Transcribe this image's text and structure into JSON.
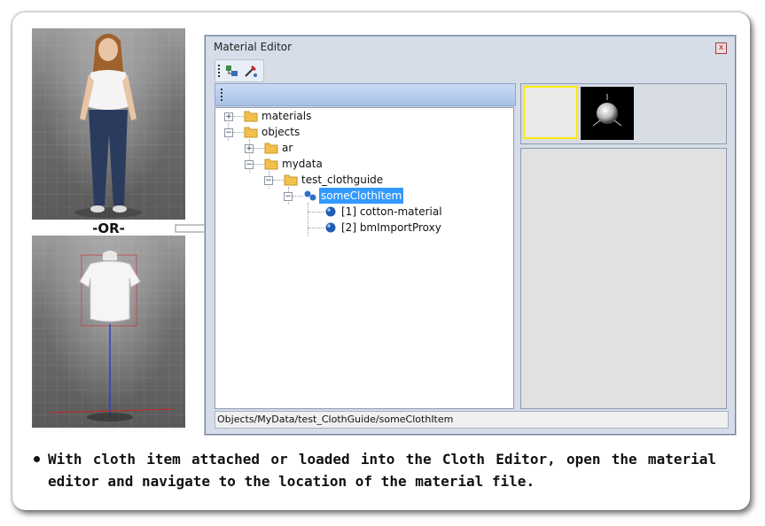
{
  "divider_label": "-OR-",
  "material_editor": {
    "title": "Material Editor",
    "close_glyph": "x",
    "toolbar_icons": [
      "add-object-icon",
      "pick-material-icon"
    ],
    "tree": {
      "nodes": [
        {
          "label": "materials"
        },
        {
          "label": "objects"
        },
        {
          "label": "ar"
        },
        {
          "label": "mydata"
        },
        {
          "label": "test_clothguide"
        },
        {
          "label": "someClothItem"
        },
        {
          "label": "[1] cotton-material"
        },
        {
          "label": "[2] bmImportProxy"
        }
      ]
    },
    "status_path": "Objects/MyData/test_ClothGuide/someClothItem"
  },
  "caption": "With cloth item attached or loaded into the Cloth Editor, open the material editor and navigate to the location of the material file.",
  "colors": {
    "selection": "#3399ff",
    "swatch_highlight": "#ffeb00",
    "window_frame": "#6f7f99"
  }
}
